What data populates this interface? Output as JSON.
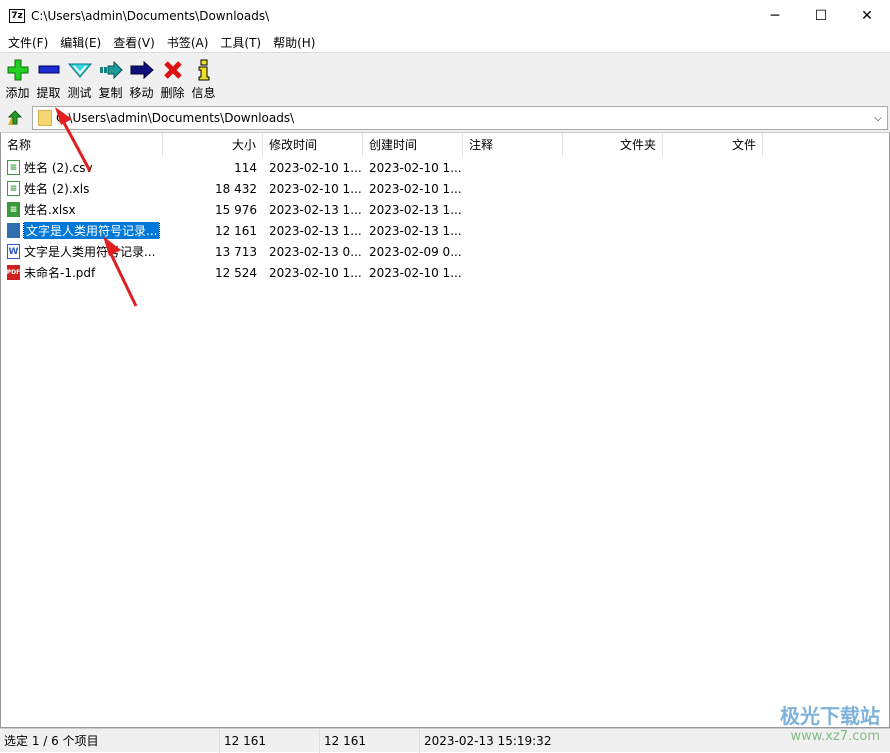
{
  "window": {
    "title": "C:\\Users\\admin\\Documents\\Downloads\\",
    "app_icon": "7z",
    "minimize": "─",
    "maximize": "☐",
    "close": "✕"
  },
  "menu": [
    "文件(F)",
    "编辑(E)",
    "查看(V)",
    "书签(A)",
    "工具(T)",
    "帮助(H)"
  ],
  "toolbar": [
    {
      "label": "添加",
      "icon": "add-icon"
    },
    {
      "label": "提取",
      "icon": "extract-icon"
    },
    {
      "label": "测试",
      "icon": "test-icon"
    },
    {
      "label": "复制",
      "icon": "copy-icon"
    },
    {
      "label": "移动",
      "icon": "move-icon"
    },
    {
      "label": "删除",
      "icon": "delete-icon"
    },
    {
      "label": "信息",
      "icon": "info-icon"
    }
  ],
  "address": {
    "value": "C:\\Users\\admin\\Documents\\Downloads\\"
  },
  "columns": [
    "名称",
    "大小",
    "修改时间",
    "创建时间",
    "注释",
    "文件夹",
    "文件"
  ],
  "files": [
    {
      "name": "姓名 (2).csv",
      "size": "114",
      "modified": "2023-02-10 1...",
      "created": "2023-02-10 1...",
      "type": "csv"
    },
    {
      "name": "姓名 (2).xls",
      "size": "18 432",
      "modified": "2023-02-10 1...",
      "created": "2023-02-10 1...",
      "type": "xls"
    },
    {
      "name": "姓名.xlsx",
      "size": "15 976",
      "modified": "2023-02-13 1...",
      "created": "2023-02-13 1...",
      "type": "xlsx"
    },
    {
      "name": "文字是人类用符号记录...",
      "size": "12 161",
      "modified": "2023-02-13 1...",
      "created": "2023-02-13 1...",
      "type": "archive",
      "selected": true
    },
    {
      "name": "文字是人类用符号记录...",
      "size": "13 713",
      "modified": "2023-02-13 0...",
      "created": "2023-02-09 0...",
      "type": "doc"
    },
    {
      "name": "未命名-1.pdf",
      "size": "12 524",
      "modified": "2023-02-10 1...",
      "created": "2023-02-10 1...",
      "type": "pdf"
    }
  ],
  "status": {
    "selection": "选定 1 / 6 个项目",
    "size": "12 161",
    "packed": "12 161",
    "date": "2023-02-13 15:19:32"
  },
  "watermark": {
    "name": "极光下载站",
    "url": "www.xz7.com"
  }
}
